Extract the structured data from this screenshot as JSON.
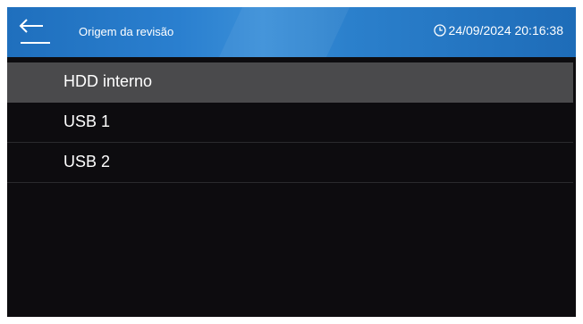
{
  "header": {
    "back_icon": "back-arrow-icon",
    "title": "Origem da revisão",
    "datetime": "24/09/2024 20:16:38",
    "clock_icon": "clock-icon"
  },
  "sources": {
    "items": [
      {
        "label": "HDD interno",
        "selected": true
      },
      {
        "label": "USB 1",
        "selected": false
      },
      {
        "label": "USB 2",
        "selected": false
      }
    ]
  },
  "colors": {
    "header": "#2a7fcf",
    "background": "#0d0c0f",
    "selected_row": "#4a4a4c"
  }
}
